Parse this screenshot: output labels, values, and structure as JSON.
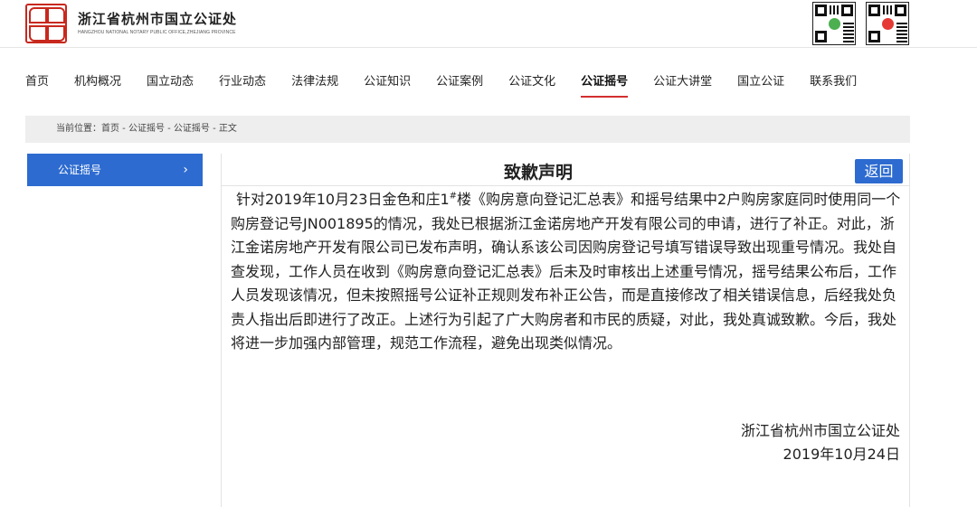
{
  "header": {
    "site_name": "浙江省杭州市国立公证处",
    "site_name_en": "HANGZHOU NATIONAL NOTARY PUBLIC OFFICE,ZHEJIANG PROVINCE",
    "qr_codes": [
      "qr-code-icon",
      "qr-code-icon"
    ],
    "accent_color": "#c8281e"
  },
  "nav": {
    "items": [
      {
        "label": "首页"
      },
      {
        "label": "机构概况"
      },
      {
        "label": "国立动态"
      },
      {
        "label": "行业动态"
      },
      {
        "label": "法律法规"
      },
      {
        "label": "公证知识"
      },
      {
        "label": "公证案例"
      },
      {
        "label": "公证文化"
      },
      {
        "label": "公证摇号"
      },
      {
        "label": "公证大讲堂"
      },
      {
        "label": "国立公证"
      },
      {
        "label": "联系我们"
      }
    ],
    "active_index": 8,
    "active_underline_color": "#d32f2f"
  },
  "breadcrumb": {
    "text": "当前位置：首页 - 公证摇号 - 公证摇号 - 正文"
  },
  "sidebar": {
    "items": [
      {
        "label": "公证摇号",
        "chevron": "›"
      }
    ],
    "active_color": "#2d6bd0"
  },
  "article": {
    "title": "致歉声明",
    "back_label": "返回",
    "body_before_sup": "针对2019年10月23日金色和庄1",
    "body_sup": "#",
    "body_after_sup": "楼《购房意向登记汇总表》和摇号结果中2户购房家庭同时使用同一个购房登记号JN001895的情况，我处已根据浙江金诺房地产开发有限公司的申请，进行了补正。对此，浙江金诺房地产开发有限公司已发布声明，确认系该公司因购房登记号填写错误导致出现重号情况。我处自查发现，工作人员在收到《购房意向登记汇总表》后未及时审核出上述重号情况，摇号结果公布后，工作人员发现该情况，但未按照摇号公证补正规则发布补正公告，而是直接修改了相关错误信息，后经我处负责人指出后即进行了改正。上述行为引起了广大购房者和市民的质疑，对此，我处真诚致歉。今后，我处将进一步加强内部管理，规范工作流程，避免出现类似情况。",
    "signature_org": "浙江省杭州市国立公证处",
    "signature_date": "2019年10月24日"
  }
}
